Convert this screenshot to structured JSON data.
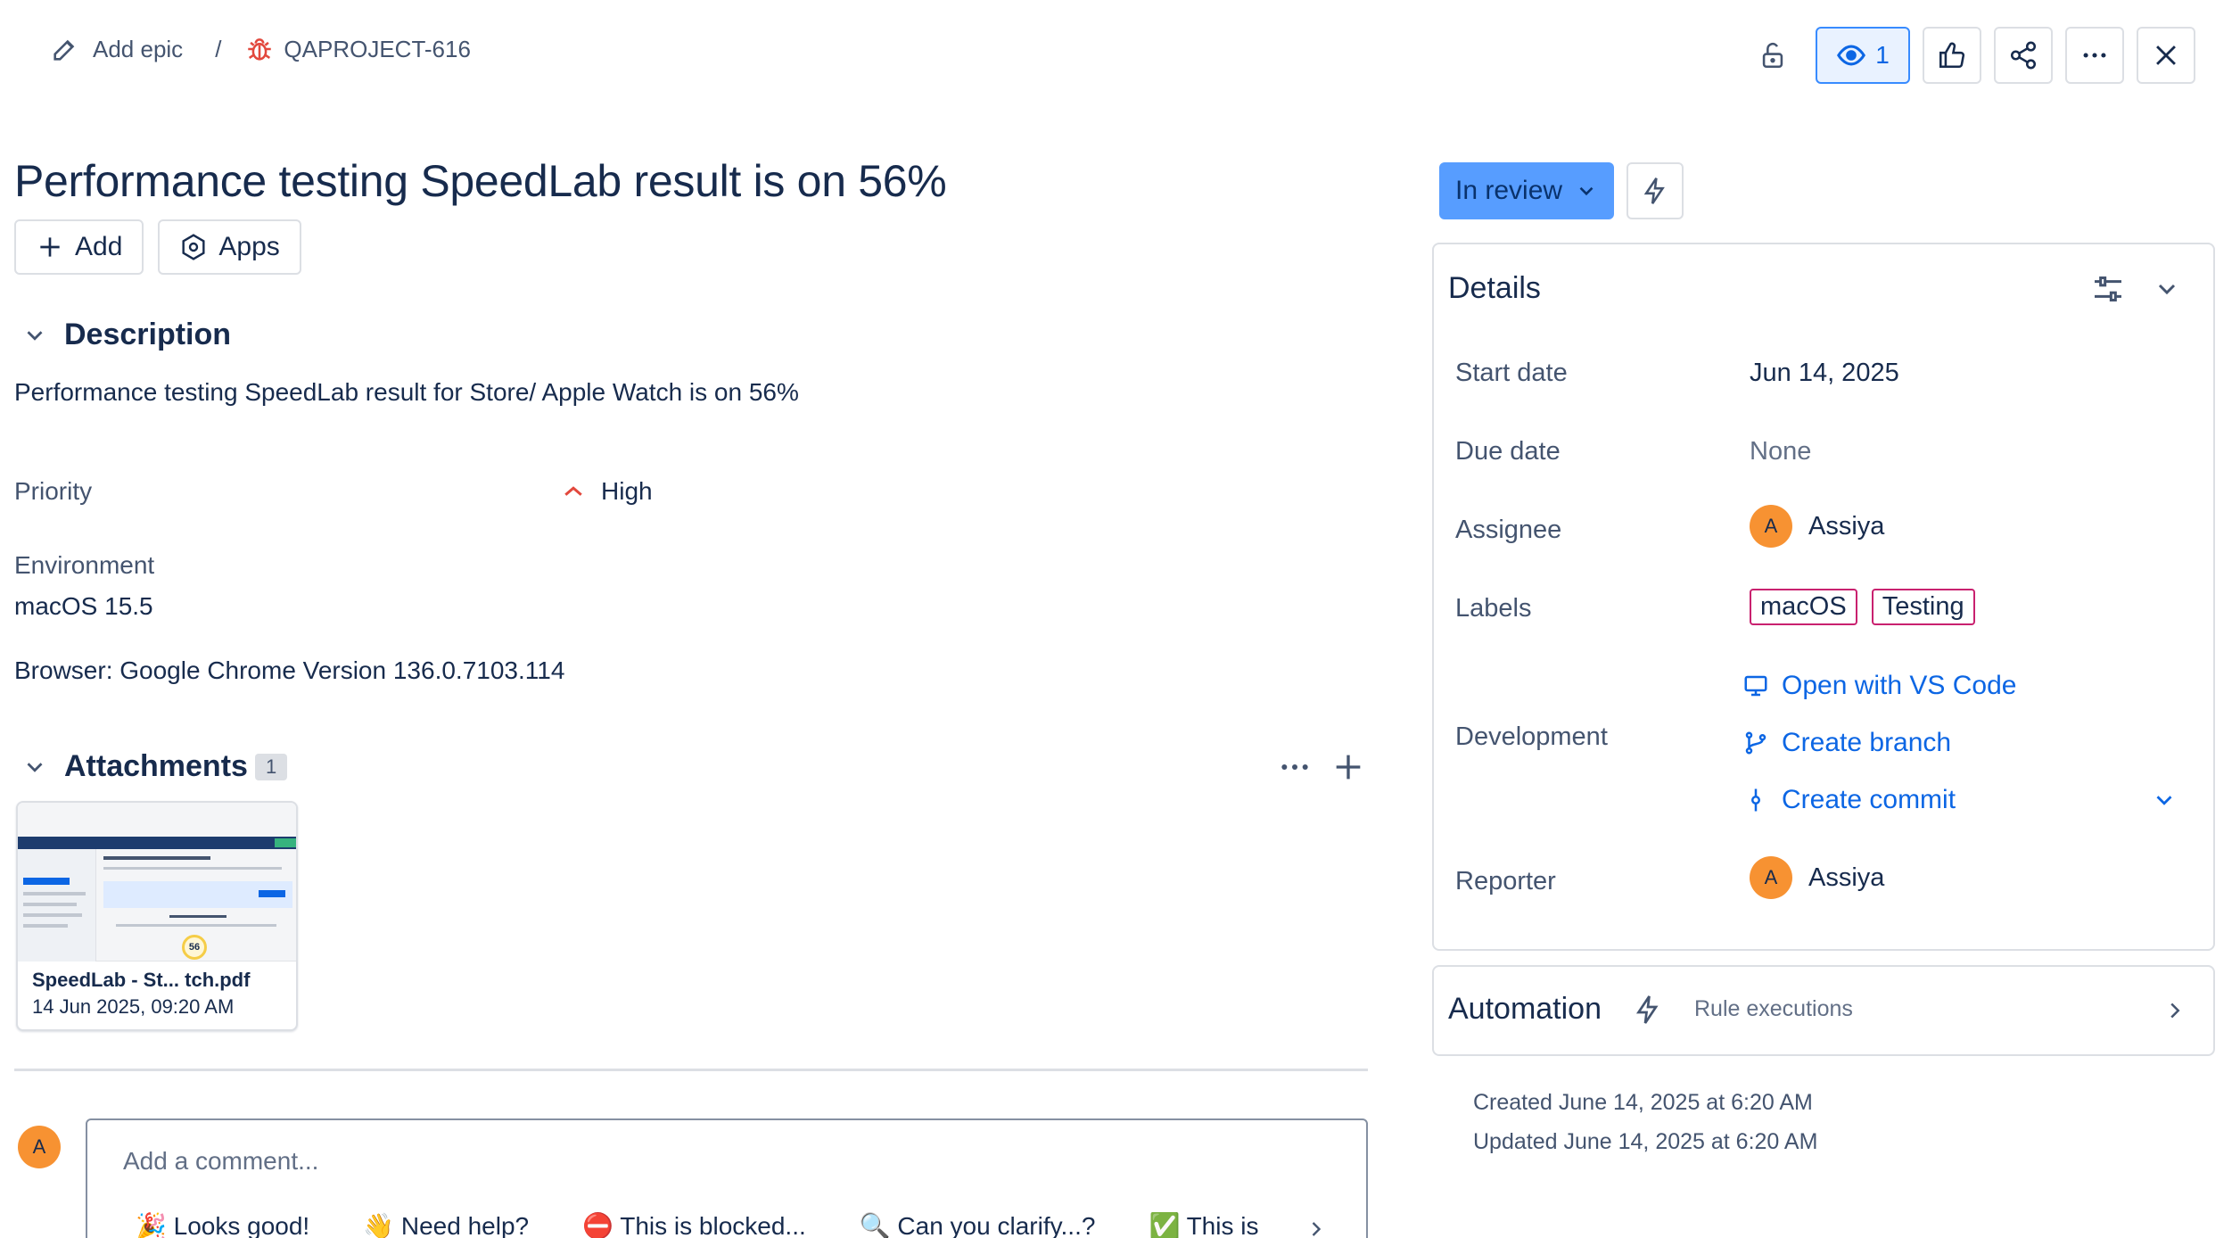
{
  "breadcrumb": {
    "add_epic": "Add epic",
    "separator": "/",
    "issue_key": "QAPROJECT-616"
  },
  "header_actions": {
    "watchers_count": "1"
  },
  "issue": {
    "title": "Performance testing SpeedLab result is on 56%",
    "add_label": "Add",
    "apps_label": "Apps"
  },
  "description": {
    "heading": "Description",
    "text": "Performance testing SpeedLab result for Store/ Apple Watch is on 56%"
  },
  "priority": {
    "label": "Priority",
    "value": "High"
  },
  "environment": {
    "label": "Environment",
    "os": "macOS 15.5",
    "browser": "Browser: Google Chrome Version 136.0.7103.114"
  },
  "attachments": {
    "heading": "Attachments",
    "count": "1",
    "items": [
      {
        "name": "SpeedLab - St...  tch.pdf",
        "date": "14 Jun 2025, 09:20 AM",
        "thumb_score": "56"
      }
    ]
  },
  "comment": {
    "avatar_initial": "A",
    "placeholder": "Add a comment...",
    "quick_replies": [
      "🎉 Looks good!",
      "👋 Need help?",
      "⛔ This is blocked...",
      "🔍 Can you clarify...?",
      "✅ This is"
    ]
  },
  "status": {
    "label": "In review"
  },
  "details": {
    "heading": "Details",
    "start_date_label": "Start date",
    "start_date_value": "Jun 14, 2025",
    "due_date_label": "Due date",
    "due_date_value": "None",
    "assignee_label": "Assignee",
    "assignee_initial": "A",
    "assignee_name": "Assiya",
    "labels_label": "Labels",
    "labels": [
      "macOS",
      "Testing"
    ],
    "development_label": "Development",
    "open_vscode": "Open with VS Code",
    "create_branch": "Create branch",
    "create_commit": "Create commit",
    "reporter_label": "Reporter",
    "reporter_initial": "A",
    "reporter_name": "Assiya"
  },
  "automation": {
    "heading": "Automation",
    "rule_executions": "Rule executions"
  },
  "meta": {
    "created": "Created June 14, 2025 at 6:20 AM",
    "updated": "Updated June 14, 2025 at 6:20 AM"
  },
  "colors": {
    "accent_blue": "#0c66e4",
    "status_blue": "#579dff",
    "avatar_orange": "#f79232",
    "bug_red": "#e2483d",
    "priority_high": "#e2483d",
    "label_border": "#c9216f"
  }
}
